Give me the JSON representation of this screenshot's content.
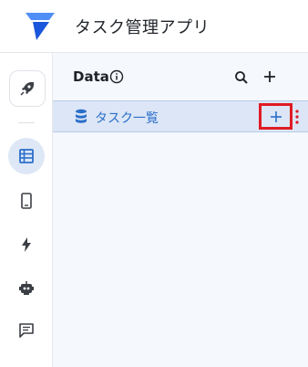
{
  "app": {
    "title": "タスク管理アプリ"
  },
  "sidebar": {
    "items": [
      {
        "icon": "rocket-icon"
      },
      {
        "icon": "table-icon",
        "active": true
      },
      {
        "icon": "phone-icon"
      },
      {
        "icon": "bolt-icon"
      },
      {
        "icon": "robot-icon"
      },
      {
        "icon": "chat-icon"
      }
    ]
  },
  "data_panel": {
    "title": "Data",
    "tables": [
      {
        "label": "タスク一覧",
        "icon": "database-icon"
      }
    ]
  },
  "colors": {
    "accent": "#2a6fc9",
    "selected_row_bg": "#dce6f6",
    "panel_bg": "#f5f8fc",
    "highlight_box": "#e01b24"
  }
}
